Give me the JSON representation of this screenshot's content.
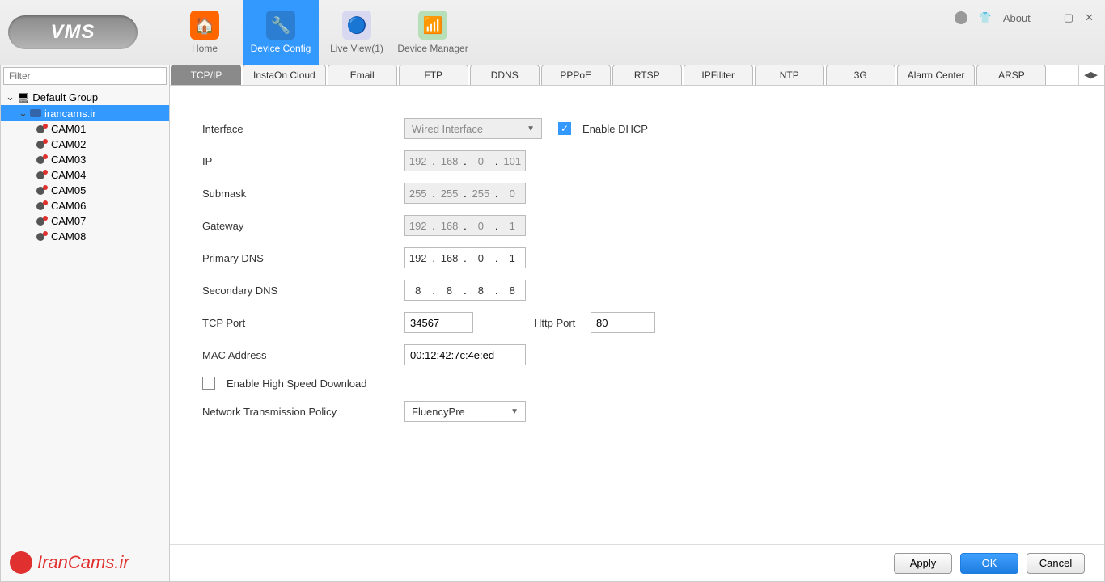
{
  "app": {
    "title": "VMS",
    "about": "About"
  },
  "nav": [
    {
      "id": "home",
      "label": "Home"
    },
    {
      "id": "config",
      "label": "Device Config",
      "active": true
    },
    {
      "id": "live",
      "label": "Live View(1)"
    },
    {
      "id": "devmgr",
      "label": "Device Manager"
    }
  ],
  "sidebar": {
    "filter_placeholder": "Filter",
    "group": "Default Group",
    "device": "irancams.ir",
    "cams": [
      "CAM01",
      "CAM02",
      "CAM03",
      "CAM04",
      "CAM05",
      "CAM06",
      "CAM07",
      "CAM08"
    ]
  },
  "tabs": [
    "TCP/IP",
    "InstaOn Cloud",
    "Email",
    "FTP",
    "DDNS",
    "PPPoE",
    "RTSP",
    "IPFiliter",
    "NTP",
    "3G",
    "Alarm Center",
    "ARSP"
  ],
  "active_tab": "TCP/IP",
  "form": {
    "interface_label": "Interface",
    "interface_value": "Wired Interface",
    "enable_dhcp_label": "Enable DHCP",
    "enable_dhcp": true,
    "ip_label": "IP",
    "ip": [
      "192",
      "168",
      "0",
      "101"
    ],
    "submask_label": "Submask",
    "submask": [
      "255",
      "255",
      "255",
      "0"
    ],
    "gateway_label": "Gateway",
    "gateway": [
      "192",
      "168",
      "0",
      "1"
    ],
    "pdns_label": "Primary DNS",
    "pdns": [
      "192",
      "168",
      "0",
      "1"
    ],
    "sdns_label": "Secondary DNS",
    "sdns": [
      "8",
      "8",
      "8",
      "8"
    ],
    "tcp_port_label": "TCP Port",
    "tcp_port": "34567",
    "http_port_label": "Http Port",
    "http_port": "80",
    "mac_label": "MAC Address",
    "mac": "00:12:42:7c:4e:ed",
    "hsd_label": "Enable High Speed Download",
    "hsd": false,
    "ntp_label": "Network Transmission Policy",
    "ntp_value": "FluencyPre"
  },
  "buttons": {
    "apply": "Apply",
    "ok": "OK",
    "cancel": "Cancel"
  },
  "watermark": "IranCams.ir"
}
